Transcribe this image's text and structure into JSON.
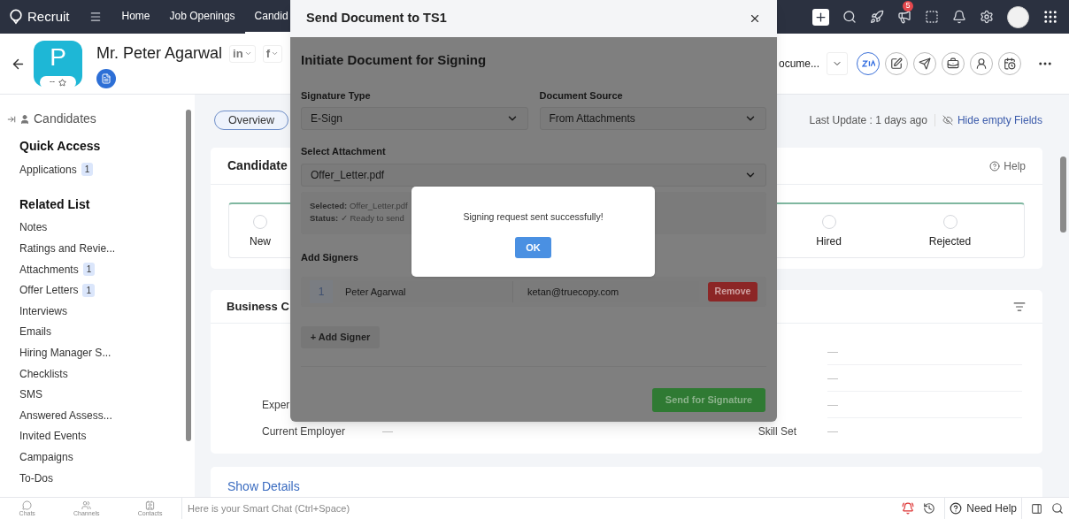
{
  "top_nav": {
    "brand": "Recruit",
    "tabs": [
      {
        "label": "Home",
        "selected": false
      },
      {
        "label": "Job Openings",
        "selected": false
      },
      {
        "label": "Candid",
        "selected": true
      }
    ],
    "notification_badge": "5"
  },
  "record": {
    "avatar_letter": "P",
    "avatar_badge": "--",
    "name": "Mr. Peter Agarwal",
    "social": [
      {
        "label": "in"
      },
      {
        "label": "f"
      }
    ],
    "document_menu": "ocume..."
  },
  "sidebar": {
    "module": "Candidates",
    "sections": [
      {
        "title": "Quick Access",
        "items": [
          {
            "label": "Applications",
            "count": "1"
          }
        ]
      },
      {
        "title": "Related List",
        "items": [
          {
            "label": "Notes"
          },
          {
            "label": "Ratings and Revie..."
          },
          {
            "label": "Attachments",
            "count": "1"
          },
          {
            "label": "Offer Letters",
            "count": "1"
          },
          {
            "label": "Interviews"
          },
          {
            "label": "Emails"
          },
          {
            "label": "Hiring Manager S..."
          },
          {
            "label": "Checklists"
          },
          {
            "label": "SMS"
          },
          {
            "label": "Answered Assess..."
          },
          {
            "label": "Invited Events"
          },
          {
            "label": "Campaigns"
          },
          {
            "label": "To-Dos"
          }
        ]
      }
    ]
  },
  "overview_tab": {
    "label": "Overview",
    "selected": true
  },
  "last_update": "Last Update : 1 days ago",
  "hide_empty": "Hide empty Fields",
  "candidate_card": {
    "title": "Candidate",
    "help": "Help",
    "stages": [
      {
        "label": "New"
      },
      {
        "label": "Hired"
      },
      {
        "label": "Rejected"
      }
    ]
  },
  "business_card": {
    "title": "Business C",
    "rows": [
      {
        "right_value": "—"
      },
      {
        "right_value": "—"
      },
      {
        "left_label": "Exper",
        "right_value": "—"
      },
      {
        "left_label": "Current Employer",
        "left_value": "—",
        "right_label": "Skill Set",
        "right_value": "—"
      }
    ]
  },
  "show_details": "Show Details",
  "modal": {
    "title": "Send Document to TS1",
    "heading": "Initiate Document for Signing",
    "signature_type": {
      "label": "Signature Type",
      "value": "E-Sign"
    },
    "document_source": {
      "label": "Document Source",
      "value": "From Attachments"
    },
    "attachment": {
      "label": "Select Attachment",
      "value": "Offer_Letter.pdf"
    },
    "summary": [
      {
        "key": "Selected:",
        "value": "Offer_Letter.pdf"
      },
      {
        "key": "Status:",
        "value": "✓ Ready to send"
      }
    ],
    "signers_label": "Add Signers",
    "signers": [
      {
        "number": "1",
        "name": "Peter Agarwal",
        "email": "ketan@truecopy.com"
      }
    ],
    "remove": "Remove",
    "add_signer": "+ Add Signer",
    "send": "Send for Signature"
  },
  "alert": {
    "message": "Signing request sent successfully!",
    "button": "OK"
  },
  "bottom_bar": {
    "dock": [
      {
        "label": "Chats"
      },
      {
        "label": "Channels"
      },
      {
        "label": "Contacts"
      }
    ],
    "smart_chat_placeholder": "Here is your Smart Chat (Ctrl+Space)",
    "need_help": "Need Help"
  }
}
